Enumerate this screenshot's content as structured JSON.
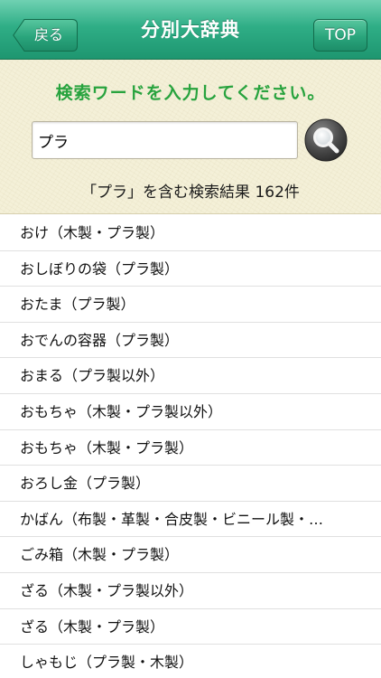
{
  "navbar": {
    "title": "分別大辞典",
    "back_label": "戻る",
    "top_label": "TOP"
  },
  "search": {
    "prompt": "検索ワードを入力してください。",
    "query": "プラ",
    "result_summary": "「プラ」を含む検索結果 162件"
  },
  "results": [
    "おけ（木製・プラ製）",
    "おしぼりの袋（プラ製）",
    "おたま（プラ製）",
    "おでんの容器（プラ製）",
    "おまる（プラ製以外）",
    "おもちゃ（木製・プラ製以外）",
    "おもちゃ（木製・プラ製）",
    "おろし金（プラ製）",
    "かばん（布製・革製・合皮製・ビニール製・…",
    "ごみ箱（木製・プラ製）",
    "ざる（木製・プラ製以外）",
    "ざる（木製・プラ製）",
    "しゃもじ（プラ製・木製）"
  ],
  "colors": {
    "navbar": "#2fae86",
    "prompt_text": "#28a33e",
    "panel_background": "#f4f0d8"
  },
  "icons": {
    "back": "chevron-left-button-shape",
    "search": "magnifier-icon"
  }
}
